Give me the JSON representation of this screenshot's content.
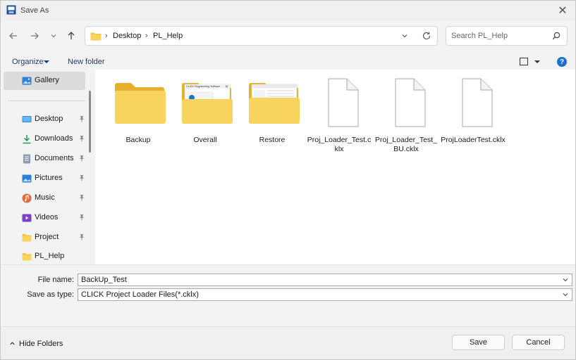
{
  "window": {
    "title": "Save As"
  },
  "nav": {
    "breadcrumb": [
      "Desktop",
      "PL_Help"
    ],
    "search_placeholder": "Search PL_Help"
  },
  "commands": {
    "organize": "Organize",
    "new_folder": "New folder"
  },
  "sidebar": {
    "items": [
      {
        "label": "Gallery",
        "icon": "gallery-icon",
        "pinned": false
      },
      {
        "label": "Desktop",
        "icon": "desktop-icon",
        "pinned": true
      },
      {
        "label": "Downloads",
        "icon": "downloads-icon",
        "pinned": true
      },
      {
        "label": "Documents",
        "icon": "documents-icon",
        "pinned": true
      },
      {
        "label": "Pictures",
        "icon": "pictures-icon",
        "pinned": true
      },
      {
        "label": "Music",
        "icon": "music-icon",
        "pinned": true
      },
      {
        "label": "Videos",
        "icon": "videos-icon",
        "pinned": true
      },
      {
        "label": "Project",
        "icon": "folder-icon",
        "pinned": true
      },
      {
        "label": "PL_Help",
        "icon": "folder-icon",
        "pinned": false
      }
    ]
  },
  "files": [
    {
      "name": "Backup",
      "type": "folder"
    },
    {
      "name": "Overall",
      "type": "folder-with-preview",
      "preview_title": "CLICK Programming Software"
    },
    {
      "name": "Restore",
      "type": "folder-with-preview"
    },
    {
      "name": "Proj_Loader_Test.cklx",
      "type": "file"
    },
    {
      "name": "Proj_Loader_Test_BU.cklx",
      "type": "file"
    },
    {
      "name": "ProjLoaderTest.cklx",
      "type": "file"
    }
  ],
  "form": {
    "file_name_label": "File name:",
    "file_name_value": "BackUp_Test",
    "save_type_label": "Save as type:",
    "save_type_value": "CLICK Project Loader Files(*.cklx)"
  },
  "footer": {
    "hide_folders": "Hide Folders",
    "save": "Save",
    "cancel": "Cancel"
  },
  "colors": {
    "accent": "#1a73c8",
    "folder": "#f4c542",
    "folder_dark": "#e8b02a"
  }
}
